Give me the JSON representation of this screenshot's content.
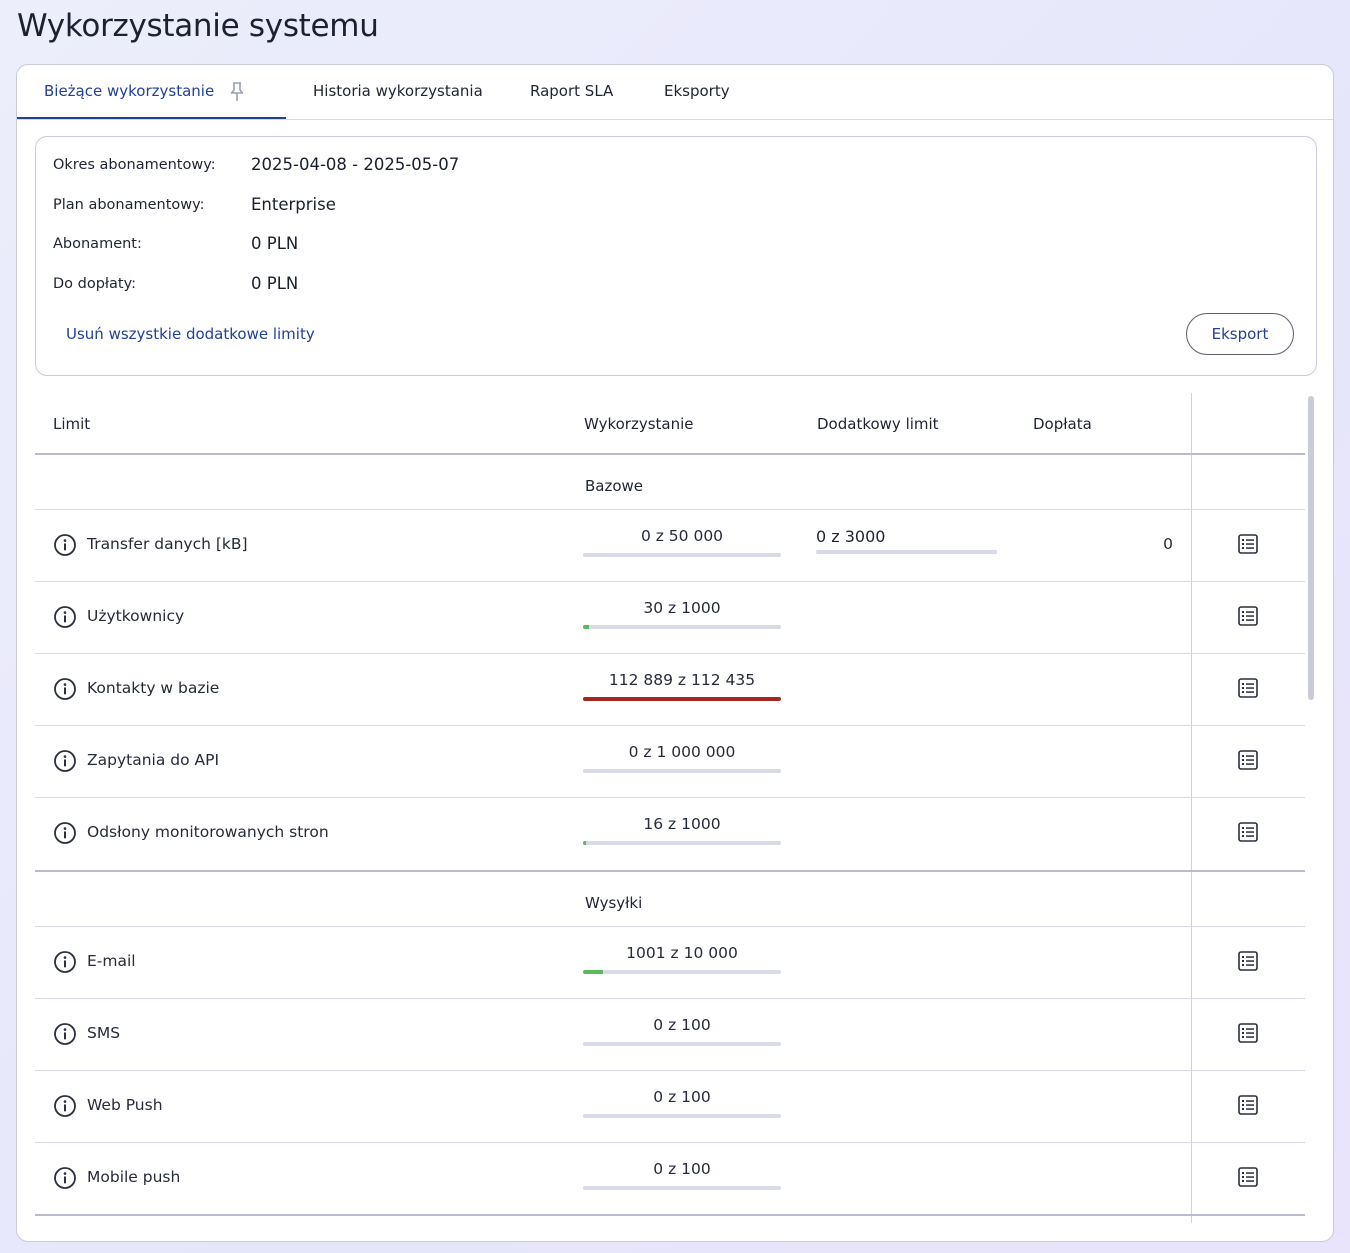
{
  "page_title": "Wykorzystanie systemu",
  "tabs": [
    {
      "label": "Bieżące wykorzystanie",
      "active": true
    },
    {
      "label": "Historia wykorzystania"
    },
    {
      "label": "Raport SLA"
    },
    {
      "label": "Eksporty"
    }
  ],
  "summary": {
    "period_label": "Okres abonamentowy:",
    "period_value": "2025-04-08 - 2025-05-07",
    "plan_label": "Plan abonamentowy:",
    "plan_value": "Enterprise",
    "fee_label": "Abonament:",
    "fee_value": "0 PLN",
    "surcharge_label": "Do dopłaty:",
    "surcharge_value": "0 PLN",
    "remove_limits_link": "Usuń wszystkie dodatkowe limity",
    "export_button": "Eksport"
  },
  "table": {
    "headers": {
      "limit": "Limit",
      "usage": "Wykorzystanie",
      "extra": "Dodatkowy limit",
      "surcharge": "Dopłata"
    },
    "sections": [
      {
        "label": "Bazowe",
        "rows": [
          {
            "name": "Transfer danych [kB]",
            "usage": "0 z 50 000",
            "usage_fraction": 0,
            "extra": "0 z 3000",
            "extra_fraction": 0,
            "surcharge": "0"
          },
          {
            "name": "Użytkownicy",
            "usage": "30 z 1000",
            "usage_fraction": 0.03
          },
          {
            "name": "Kontakty w bazie",
            "usage": "112 889 z 112 435",
            "usage_fraction": 1,
            "over_limit": true
          },
          {
            "name": "Zapytania do API",
            "usage": "0 z 1 000 000",
            "usage_fraction": 0
          },
          {
            "name": "Odsłony monitorowanych stron",
            "usage": "16 z 1000",
            "usage_fraction": 0.016
          }
        ]
      },
      {
        "label": "Wysyłki",
        "rows": [
          {
            "name": "E-mail",
            "usage": "1001 z 10 000",
            "usage_fraction": 0.1001
          },
          {
            "name": "SMS",
            "usage": "0 z 100",
            "usage_fraction": 0
          },
          {
            "name": "Web Push",
            "usage": "0 z 100",
            "usage_fraction": 0
          },
          {
            "name": "Mobile push",
            "usage": "0 z 100",
            "usage_fraction": 0
          }
        ]
      }
    ]
  },
  "colors": {
    "accent": "#21409a",
    "bar_track": "#d8dbe7",
    "bar_ok": "#5cb85c",
    "bar_over": "#a3281f"
  },
  "icons": {
    "pin": "pin-icon",
    "info": "info-icon",
    "detail": "list-detail-icon"
  }
}
